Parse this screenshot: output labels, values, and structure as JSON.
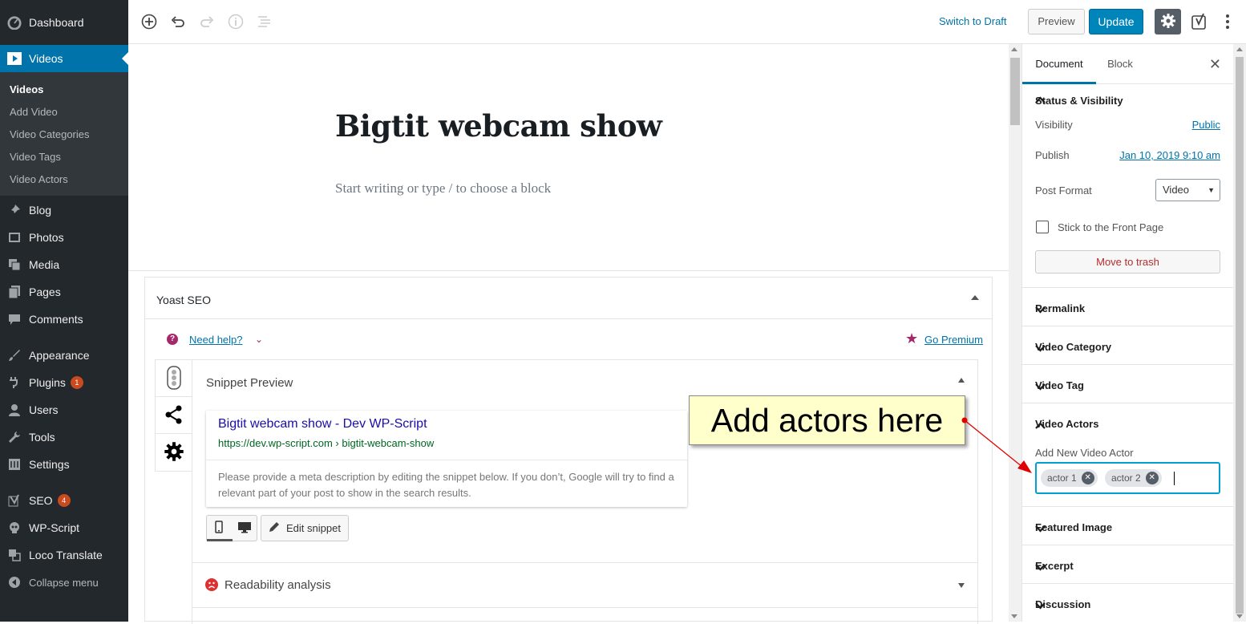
{
  "admin_menu": {
    "items": [
      {
        "label": "Dashboard",
        "icon": "dashboard-icon"
      },
      {
        "label": "Videos",
        "icon": "video-icon"
      },
      {
        "label": "Blog",
        "icon": "pin-icon"
      },
      {
        "label": "Photos",
        "icon": "photos-icon"
      },
      {
        "label": "Media",
        "icon": "media-icon"
      },
      {
        "label": "Pages",
        "icon": "pages-icon"
      },
      {
        "label": "Comments",
        "icon": "comments-icon"
      },
      {
        "label": "Appearance",
        "icon": "brush-icon"
      },
      {
        "label": "Plugins",
        "icon": "plugin-icon",
        "badge": "1"
      },
      {
        "label": "Users",
        "icon": "users-icon"
      },
      {
        "label": "Tools",
        "icon": "wrench-icon"
      },
      {
        "label": "Settings",
        "icon": "settings-icon"
      },
      {
        "label": "SEO",
        "icon": "yoast-icon",
        "badge": "4"
      },
      {
        "label": "WP-Script",
        "icon": "skull-icon"
      },
      {
        "label": "Loco Translate",
        "icon": "translate-icon"
      },
      {
        "label": "Collapse menu",
        "icon": "collapse-icon"
      }
    ],
    "videos_submenu": [
      "Videos",
      "Add Video",
      "Video Categories",
      "Video Tags",
      "Video Actors"
    ]
  },
  "toolbar": {
    "switch_to_draft": "Switch to Draft",
    "preview": "Preview",
    "update": "Update"
  },
  "editor": {
    "title": "Bigtit webcam show",
    "placeholder": "Start writing or type / to choose a block"
  },
  "yoast": {
    "title": "Yoast SEO",
    "need_help": "Need help?",
    "go_premium": "Go Premium",
    "snippet_preview": "Snippet Preview",
    "snippet_title": "Bigtit webcam show - Dev WP-Script",
    "snippet_url": "https://dev.wp-script.com › bigtit-webcam-show",
    "snippet_desc": "Please provide a meta description by editing the snippet below. If you don’t, Google will try to find a relevant part of your post to show in the search results.",
    "edit_snippet": "Edit snippet",
    "readability": "Readability analysis"
  },
  "callout": "Add actors here",
  "sidebar": {
    "tab_document": "Document",
    "tab_block": "Block",
    "status_title": "Status & Visibility",
    "visibility_label": "Visibility",
    "visibility_value": "Public",
    "publish_label": "Publish",
    "publish_value": "Jan 10, 2019 9:10 am",
    "post_format_label": "Post Format",
    "post_format_value": "Video",
    "sticky_label": "Stick to the Front Page",
    "trash": "Move to trash",
    "permalink": "Permalink",
    "video_category": "Video Category",
    "video_tag": "Video Tag",
    "video_actors": "Video Actors",
    "add_actor_label": "Add New Video Actor",
    "actors": [
      "actor 1",
      "actor 2"
    ],
    "featured_image": "Featured Image",
    "excerpt": "Excerpt",
    "discussion": "Discussion"
  },
  "colors": {
    "accent": "#0073aa",
    "admin_bg": "#23282d",
    "callout_bg": "#ffffcc",
    "arrow": "#e00000"
  }
}
